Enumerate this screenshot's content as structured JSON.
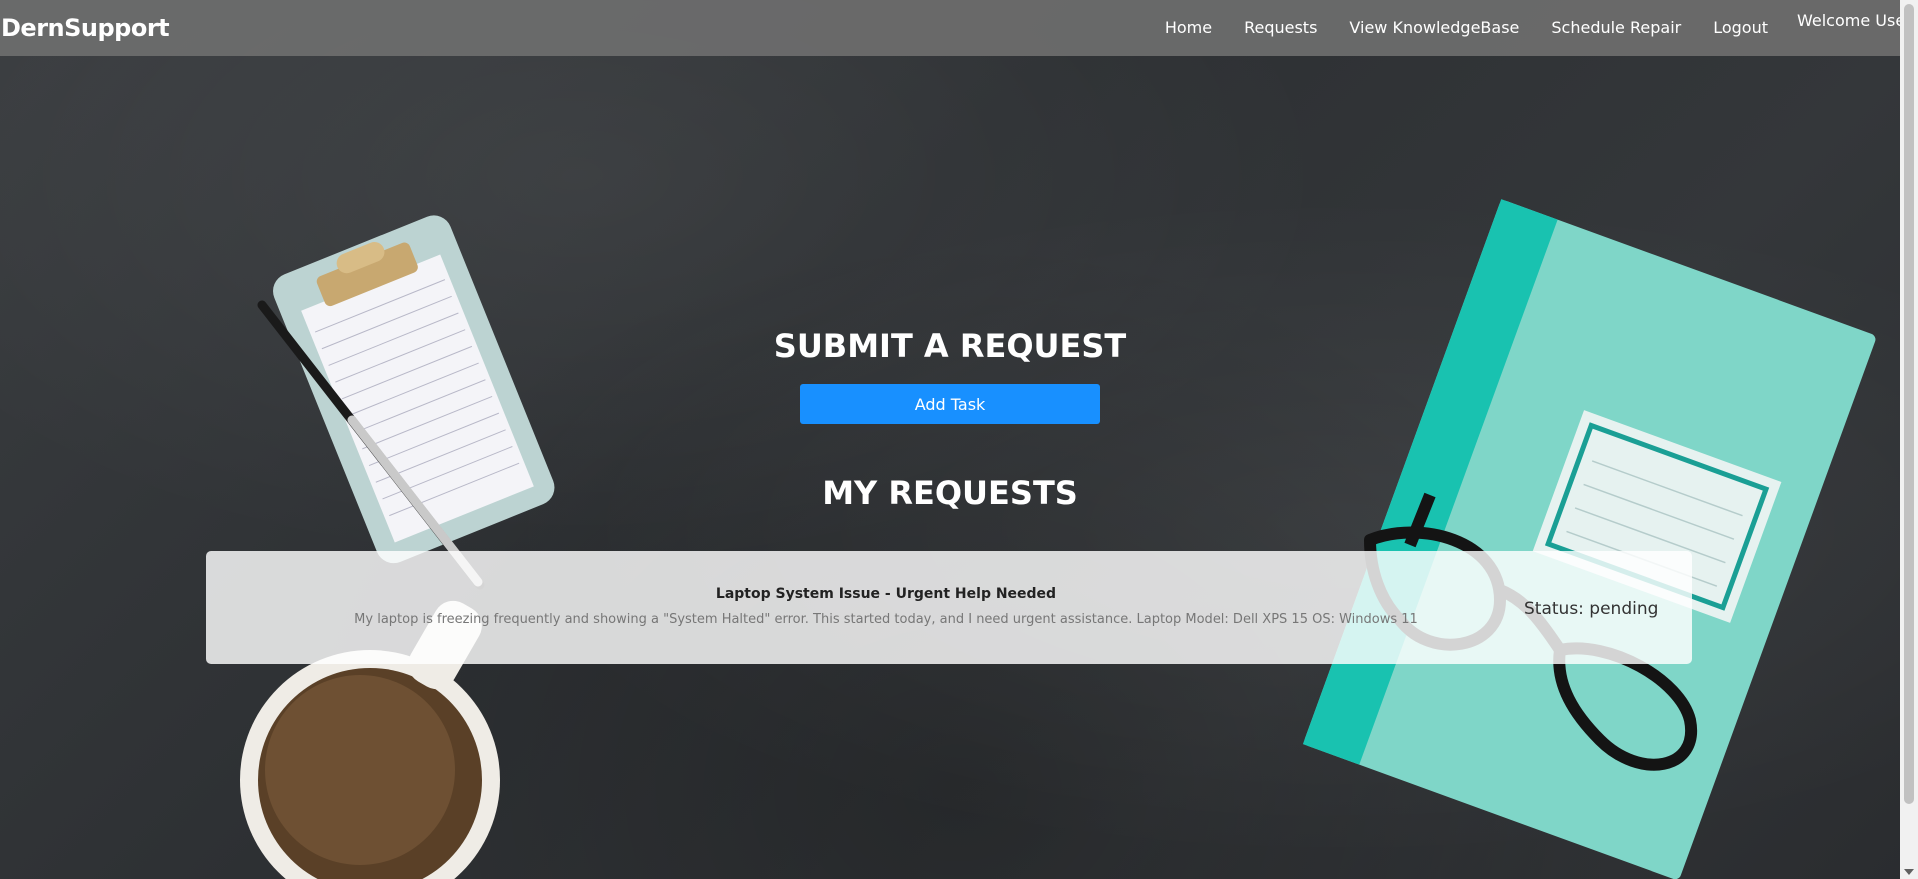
{
  "header": {
    "brand": "DernSupport",
    "nav": [
      "Home",
      "Requests",
      "View KnowledgeBase",
      "Schedule Repair",
      "Logout"
    ],
    "welcome": "Welcome User"
  },
  "main": {
    "submit_title": "SUBMIT A REQUEST",
    "add_task_label": "Add Task",
    "requests_title": "MY REQUESTS",
    "requests": [
      {
        "title": "Laptop System Issue - Urgent Help Needed",
        "description": "My laptop is freezing frequently and showing a \"System Halted\" error. This started today, and I need urgent assistance. Laptop Model: Dell XPS 15 OS: Windows 11",
        "status": "Status: pending"
      }
    ]
  },
  "colors": {
    "accent": "#1890ff",
    "navbar": "#6e6e6e",
    "background": "#2f3235"
  }
}
